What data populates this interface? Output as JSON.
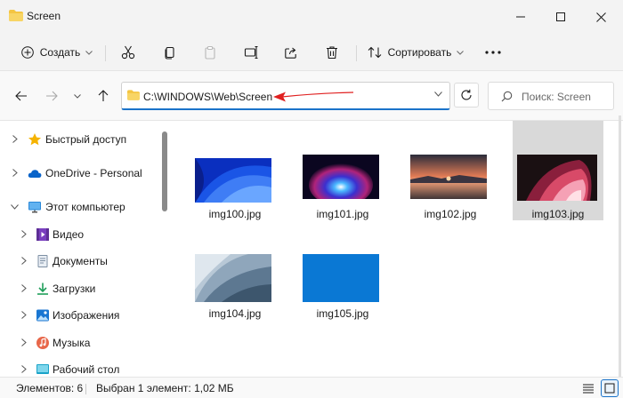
{
  "window": {
    "title": "Screen"
  },
  "toolbar": {
    "new_label": "Создать",
    "sort_label": "Сортировать"
  },
  "address": {
    "path": "C:\\WINDOWS\\Web\\Screen",
    "search_placeholder": "Поиск: Screen"
  },
  "sidebar": {
    "items": [
      {
        "label": "Быстрый доступ",
        "icon": "star-icon"
      },
      {
        "label": "OneDrive - Personal",
        "icon": "cloud-icon"
      },
      {
        "label": "Этот компьютер",
        "icon": "monitor-icon"
      },
      {
        "label": "Видео",
        "icon": "video-icon"
      },
      {
        "label": "Документы",
        "icon": "documents-icon"
      },
      {
        "label": "Загрузки",
        "icon": "downloads-icon"
      },
      {
        "label": "Изображения",
        "icon": "pictures-icon"
      },
      {
        "label": "Музыка",
        "icon": "music-icon"
      },
      {
        "label": "Рабочий стол",
        "icon": "desktop-icon"
      }
    ]
  },
  "files": [
    {
      "name": "img100.jpg",
      "selected": false
    },
    {
      "name": "img101.jpg",
      "selected": false
    },
    {
      "name": "img102.jpg",
      "selected": false
    },
    {
      "name": "img103.jpg",
      "selected": true
    },
    {
      "name": "img104.jpg",
      "selected": false
    },
    {
      "name": "img105.jpg",
      "selected": false
    }
  ],
  "status": {
    "count": "Элементов: 6",
    "selection": "Выбран 1 элемент: 1,02 МБ"
  },
  "colors": {
    "accent": "#1a73c9",
    "folder": "#f4c542",
    "annotation_arrow": "#e02020",
    "selection_bg": "#d9d9d9"
  }
}
